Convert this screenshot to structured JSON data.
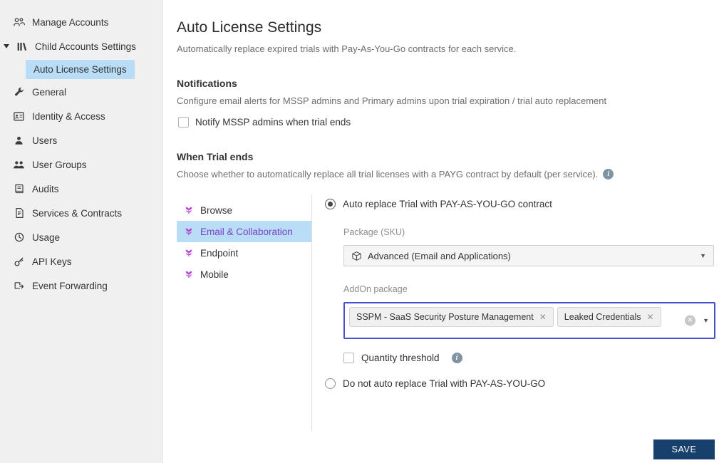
{
  "sidebar": {
    "items": [
      {
        "label": "Manage Accounts",
        "icon": "people-group-icon"
      },
      {
        "label": "Child Accounts Settings",
        "icon": "accounts-ledger-icon",
        "expanded": true
      },
      {
        "label": "Auto License Settings",
        "selected": true,
        "child_of": "Child Accounts Settings"
      },
      {
        "label": "General",
        "icon": "wrench-icon"
      },
      {
        "label": "Identity & Access",
        "icon": "id-card-icon"
      },
      {
        "label": "Users",
        "icon": "user-icon"
      },
      {
        "label": "User Groups",
        "icon": "users-icon"
      },
      {
        "label": "Audits",
        "icon": "book-icon"
      },
      {
        "label": "Services & Contracts",
        "icon": "contract-icon"
      },
      {
        "label": "Usage",
        "icon": "clock-icon"
      },
      {
        "label": "API Keys",
        "icon": "key-icon"
      },
      {
        "label": "Event Forwarding",
        "icon": "forward-icon"
      }
    ]
  },
  "main": {
    "title": "Auto License Settings",
    "subtitle": "Automatically replace expired trials with Pay-As-You-Go contracts for each service.",
    "notifications": {
      "heading": "Notifications",
      "description": "Configure email alerts for MSSP admins and Primary admins upon trial expiration / trial auto replacement",
      "checkbox_label": "Notify MSSP admins when trial ends",
      "checked": false
    },
    "trial": {
      "heading": "When Trial ends",
      "description": "Choose whether to automatically replace all trial licenses with a PAYG contract by default (per service).",
      "services": [
        {
          "label": "Browse",
          "icon": "tulip-icon"
        },
        {
          "label": "Email & Collaboration",
          "icon": "tulip-icon",
          "selected": true
        },
        {
          "label": "Endpoint",
          "icon": "tulip-icon"
        },
        {
          "label": "Mobile",
          "icon": "tulip-icon"
        }
      ],
      "auto_replace_label": "Auto replace Trial with PAY-AS-YOU-GO contract",
      "auto_replace_selected": true,
      "package_label": "Package (SKU)",
      "package_value": "Advanced (Email and Applications)",
      "addon_label": "AddOn package",
      "addon_tags": [
        "SSPM - SaaS Security Posture Management",
        "Leaked Credentials"
      ],
      "quantity_label": "Quantity threshold",
      "quantity_checked": false,
      "no_replace_label": "Do not auto replace Trial with PAY-AS-YOU-GO",
      "no_replace_selected": false
    },
    "save_label": "SAVE"
  },
  "colors": {
    "selection_highlight": "#b9ddf6",
    "focus_border": "#4650c9",
    "save_button": "#17406d",
    "service_icon": "#b13bd1",
    "info_icon": "#7f93a3"
  }
}
